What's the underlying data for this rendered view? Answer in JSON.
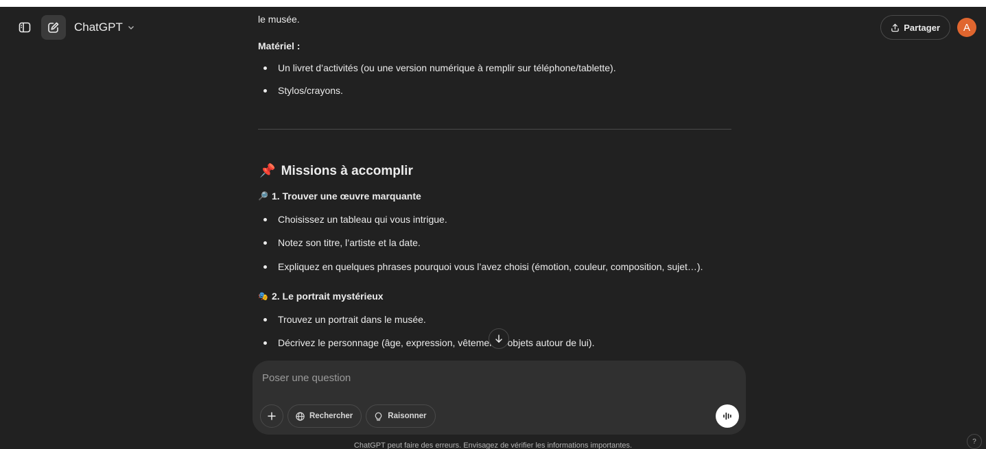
{
  "header": {
    "model_name": "ChatGPT",
    "share_label": "Partager",
    "avatar_letter": "A"
  },
  "message": {
    "top_line": "le musée.",
    "materiel_label": "Matériel :",
    "materiel_items": [
      "Un livret d’activités (ou une version numérique à remplir sur téléphone/tablette).",
      "Stylos/crayons."
    ],
    "missions_heading": "Missions à accomplir",
    "missions_emoji": "📌",
    "mission1": {
      "emoji": "🔎",
      "title": "1. Trouver une œuvre marquante",
      "items": [
        "Choisissez un tableau qui vous intrigue.",
        "Notez son titre, l’artiste et la date.",
        "Expliquez en quelques phrases pourquoi vous l’avez choisi (émotion, couleur, composition, sujet…)."
      ]
    },
    "mission2": {
      "emoji": "🎭",
      "title": "2. Le portrait mystérieux",
      "items": [
        "Trouvez un portrait dans le musée.",
        "Décrivez le personnage (âge, expression, vêtements, objets autour de lui)."
      ]
    }
  },
  "composer": {
    "placeholder": "Poser une question",
    "search_label": "Rechercher",
    "reason_label": "Raisonner"
  },
  "footer": {
    "disclaimer": "ChatGPT peut faire des erreurs. Envisagez de vérifier les informations importantes.",
    "help_label": "?"
  },
  "colors": {
    "background": "#212121",
    "composer": "#303030",
    "avatar": "#e0662f"
  }
}
